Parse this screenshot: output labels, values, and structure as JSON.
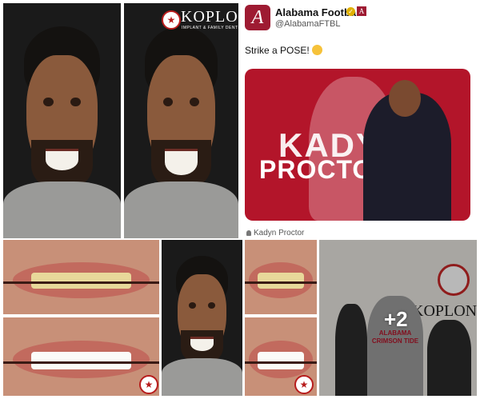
{
  "photos": {
    "top_left": {
      "label": "before-smile-photo"
    },
    "top_mid": {
      "logo_text": "KOPLON",
      "logo_sub": "IMPLANT & FAMILY DENTISTRY"
    }
  },
  "tweet": {
    "account_name": "Alabama Football",
    "handle": "@AlabamaFTBL",
    "avatar_letter": "A",
    "badge_letter": "A",
    "text": "Strike a POSE!",
    "media_text_line1": "KADYN",
    "media_text_line2": "PROCTOR",
    "tag": "Kadyn Proctor"
  },
  "gallery": {
    "more_count": "+2",
    "group_sign": "KOPLON",
    "shirt_text_line1": "ALABAMA",
    "shirt_text_line2": "CRIMSON TIDE"
  },
  "colors": {
    "crimson": "#9e1b32",
    "media_red": "#b3152a"
  }
}
